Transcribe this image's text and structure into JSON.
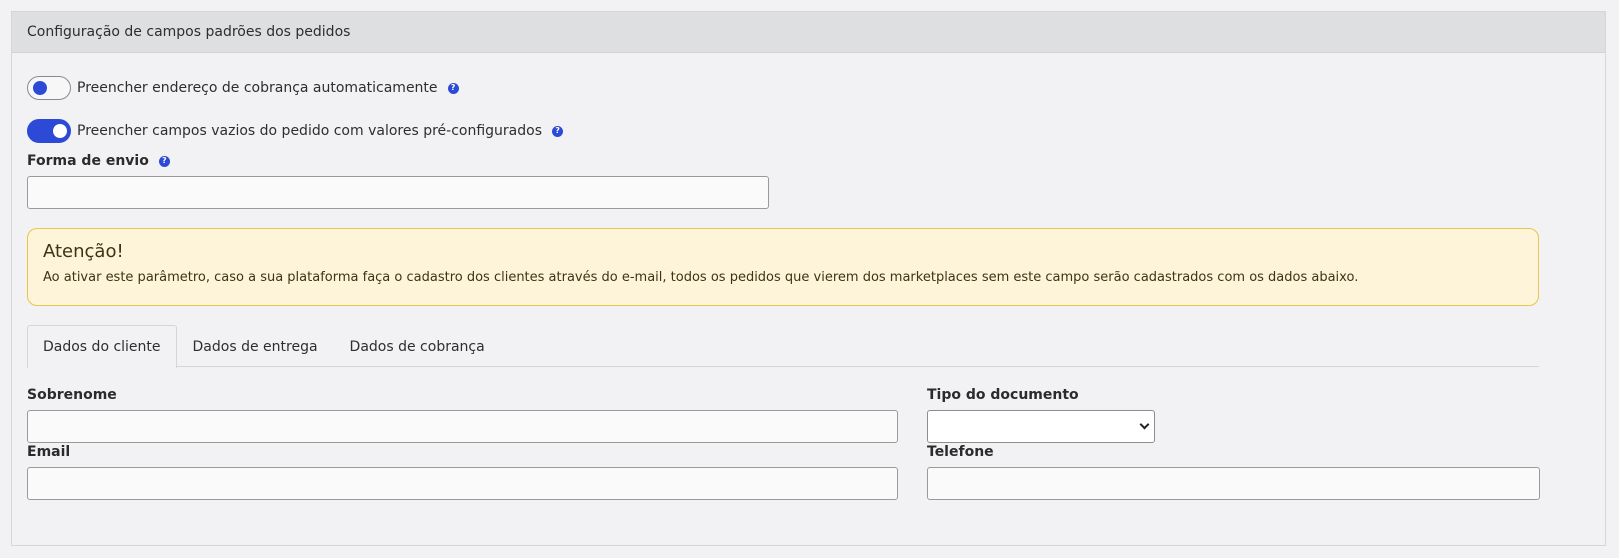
{
  "panel": {
    "title": "Configuração de campos padrões dos pedidos"
  },
  "toggles": [
    {
      "label": "Preencher endereço de cobrança automaticamente",
      "state": "off",
      "help_icon": "question-circle-icon"
    },
    {
      "label": "Preencher campos vazios do pedido com valores pré-configurados",
      "state": "on",
      "help_icon": "question-circle-icon"
    }
  ],
  "shipping": {
    "label": "Forma de envio",
    "value": "",
    "help_icon": "question-circle-icon"
  },
  "alert": {
    "title": "Atenção!",
    "text": "Ao ativar este parâmetro, caso a sua plataforma faça o cadastro dos clientes através do e-mail, todos os pedidos que vierem dos marketplaces sem este campo serão cadastrados com os dados abaixo."
  },
  "tabs": [
    {
      "label": "Dados do cliente",
      "active": true
    },
    {
      "label": "Dados de entrega",
      "active": false
    },
    {
      "label": "Dados de cobrança",
      "active": false
    }
  ],
  "form": {
    "sobrenome": {
      "label": "Sobrenome",
      "value": ""
    },
    "tipo_documento": {
      "label": "Tipo do documento",
      "selected": ""
    },
    "email": {
      "label": "Email",
      "value": ""
    },
    "telefone": {
      "label": "Telefone",
      "value": ""
    }
  },
  "colors": {
    "accent": "#2d4ad6",
    "alert_bg": "#fdf4d9",
    "alert_border": "#e7c64a",
    "header_bg": "#dedfe1"
  }
}
